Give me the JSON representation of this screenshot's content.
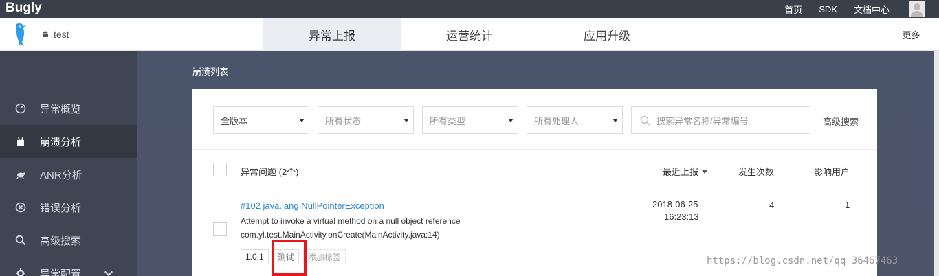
{
  "topbar": {
    "brand": "Bugly",
    "nav": [
      "首页",
      "SDK",
      "文档中心"
    ]
  },
  "appbar": {
    "app_name": "test",
    "tabs": [
      "异常上报",
      "运营统计",
      "应用升级"
    ],
    "more": "更多"
  },
  "sidebar": {
    "items": [
      "异常概览",
      "崩溃分析",
      "ANR分析",
      "错误分析",
      "高级搜索",
      "异常配置"
    ]
  },
  "main": {
    "breadcrumb": "崩溃列表",
    "filters": {
      "version": "全版本",
      "status": "所有状态",
      "type": "所有类型",
      "handler": "所有处理人",
      "search_placeholder": "搜索异常名称/异常编号",
      "advanced": "高级搜索"
    },
    "table": {
      "headers": {
        "issue": "异常问题 (2个)",
        "latest": "最近上报",
        "count": "发生次数",
        "users": "影响用户"
      },
      "rows": [
        {
          "title": "#102 java.lang.NullPointerException",
          "message": "Attempt to invoke a virtual method on a null object reference",
          "location": "com.yl.test.MainActivity.onCreate(MainActivity.java:14)",
          "date": "2018-06-25",
          "time": "16:23:13",
          "count": "4",
          "users": "1",
          "tags": [
            "1.0.1",
            "测试"
          ],
          "add_tag": "添加标签"
        }
      ]
    }
  },
  "watermark": "https://blog.csdn.net/qq_36467463",
  "colors": {
    "topbar": "#3a4049",
    "sidebar": "#3f4552",
    "link": "#2a87d6",
    "highlight": "#e8151b"
  }
}
